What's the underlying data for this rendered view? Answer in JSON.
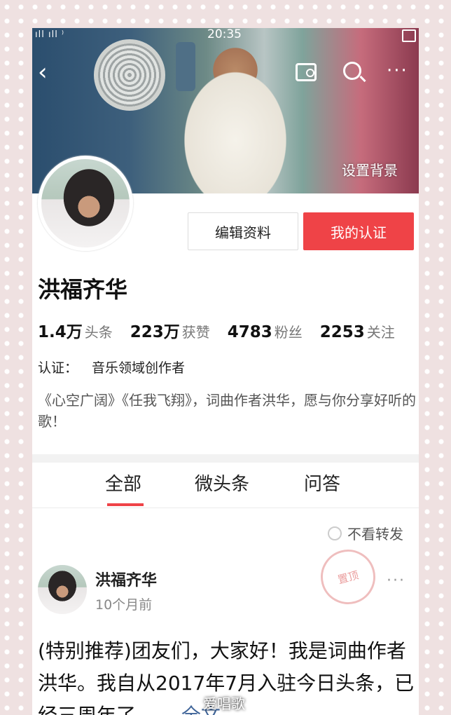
{
  "status_bar": {
    "signal": "ıll ıll ⁾",
    "time": "20:35"
  },
  "header": {
    "back_icon": "‹",
    "more_icon": "···",
    "set_background": "设置背景"
  },
  "actions": {
    "edit_profile": "编辑资料",
    "my_certification": "我的认证"
  },
  "profile": {
    "name": "洪福齐华",
    "stats": [
      {
        "value": "1.4万",
        "label": "头条"
      },
      {
        "value": "223万",
        "label": "获赞"
      },
      {
        "value": "4783",
        "label": "粉丝"
      },
      {
        "value": "2253",
        "label": "关注"
      }
    ],
    "certification_label": "认证：",
    "certification_value": "音乐领域创作者",
    "intro": "《心空广阔》《任我飞翔》，词曲作者洪华，愿与你分享好听的歌！"
  },
  "tabs": [
    {
      "label": "全部",
      "active": true
    },
    {
      "label": "微头条"
    },
    {
      "label": "问答"
    }
  ],
  "filter": {
    "no_repost": "不看转发"
  },
  "post": {
    "author": "洪福齐华",
    "time": "10个月前",
    "stamp": "置顶",
    "more_icon": "···",
    "text": "(特别推荐)团友们，大家好！我是词曲作者洪华。我自从2017年7月入驻今日头条，已经三周年了……",
    "full_text_link": "全文"
  },
  "watermark": "爱唱歌",
  "colors": {
    "accent": "#ef4347",
    "link": "#406599"
  }
}
